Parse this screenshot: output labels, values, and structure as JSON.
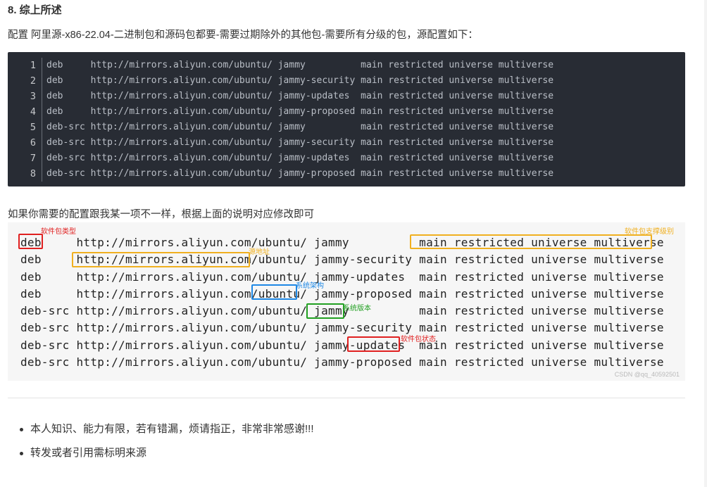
{
  "heading": "8. 综上所述",
  "intro": "配置 阿里源-x86-22.04-二进制包和源码包都要-需要过期除外的其他包-需要所有分级的包，源配置如下：",
  "code": {
    "line_numbers": [
      "1",
      "2",
      "3",
      "4",
      "5",
      "6",
      "7",
      "8"
    ],
    "lines": [
      "deb     http://mirrors.aliyun.com/ubuntu/ jammy          main restricted universe multiverse",
      "deb     http://mirrors.aliyun.com/ubuntu/ jammy-security main restricted universe multiverse",
      "deb     http://mirrors.aliyun.com/ubuntu/ jammy-updates  main restricted universe multiverse",
      "deb     http://mirrors.aliyun.com/ubuntu/ jammy-proposed main restricted universe multiverse",
      "deb-src http://mirrors.aliyun.com/ubuntu/ jammy          main restricted universe multiverse",
      "deb-src http://mirrors.aliyun.com/ubuntu/ jammy-security main restricted universe multiverse",
      "deb-src http://mirrors.aliyun.com/ubuntu/ jammy-updates  main restricted universe multiverse",
      "deb-src http://mirrors.aliyun.com/ubuntu/ jammy-proposed main restricted universe multiverse"
    ]
  },
  "note": "如果你需要的配置跟我某一项不一样，根据上面的说明对应修改即可",
  "image": {
    "lines": [
      "deb     http://mirrors.aliyun.com/ubuntu/ jammy          main restricted universe multiverse",
      "deb     http://mirrors.aliyun.com/ubuntu/ jammy-security main restricted universe multiverse",
      "deb     http://mirrors.aliyun.com/ubuntu/ jammy-updates  main restricted universe multiverse",
      "deb     http://mirrors.aliyun.com/ubuntu/ jammy-proposed main restricted universe multiverse",
      "deb-src http://mirrors.aliyun.com/ubuntu/ jammy          main restricted universe multiverse",
      "deb-src http://mirrors.aliyun.com/ubuntu/ jammy-security main restricted universe multiverse",
      "deb-src http://mirrors.aliyun.com/ubuntu/ jammy-updates  main restricted universe multiverse",
      "deb-src http://mirrors.aliyun.com/ubuntu/ jammy-proposed main restricted universe multiverse"
    ],
    "annotations": {
      "package_type": {
        "label": "软件包类型",
        "color": "#e02020"
      },
      "url": {
        "label": "源地址",
        "color": "#f0b020"
      },
      "arch": {
        "label": "系统架构",
        "color": "#1e88e5"
      },
      "version": {
        "label": "系统版本",
        "color": "#22a022"
      },
      "status": {
        "label": "软件包状态",
        "color": "#e02020"
      },
      "support_level": {
        "label": "软件包支撑级别",
        "color": "#f0b020"
      }
    },
    "watermark": "CSDN @qq_40592501"
  },
  "bullets": [
    "本人知识、能力有限，若有错漏，烦请指正，非常非常感谢!!!",
    "转发或者引用需标明来源"
  ]
}
